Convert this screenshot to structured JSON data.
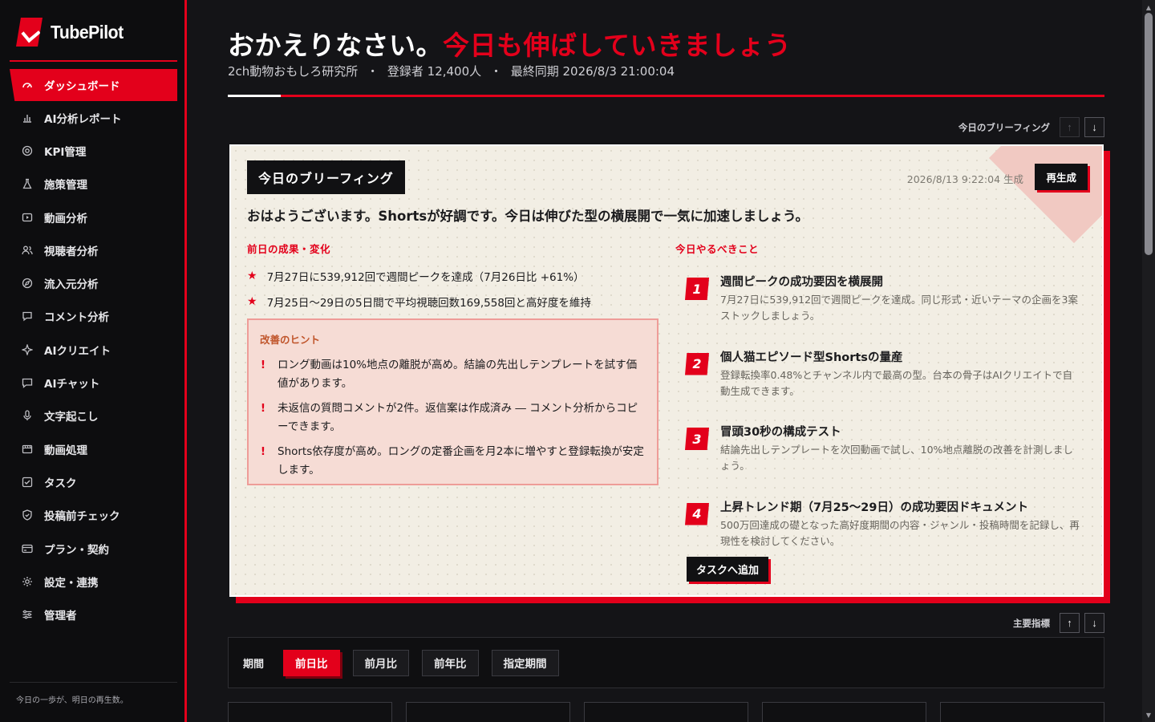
{
  "app": {
    "name": "TubePilot",
    "footer": "今日の一歩が、明日の再生数。"
  },
  "sidebar": {
    "items": [
      {
        "label": "ダッシュボード",
        "icon": "gauge"
      },
      {
        "label": "AI分析レポート",
        "icon": "bar-chart"
      },
      {
        "label": "KPI管理",
        "icon": "target"
      },
      {
        "label": "施策管理",
        "icon": "flask"
      },
      {
        "label": "動画分析",
        "icon": "play"
      },
      {
        "label": "視聴者分析",
        "icon": "users"
      },
      {
        "label": "流入元分析",
        "icon": "compass"
      },
      {
        "label": "コメント分析",
        "icon": "comment"
      },
      {
        "label": "AIクリエイト",
        "icon": "sparkle"
      },
      {
        "label": "AIチャット",
        "icon": "chat"
      },
      {
        "label": "文字起こし",
        "icon": "mic"
      },
      {
        "label": "動画処理",
        "icon": "film"
      },
      {
        "label": "タスク",
        "icon": "check-square"
      },
      {
        "label": "投稿前チェック",
        "icon": "shield"
      },
      {
        "label": "プラン・契約",
        "icon": "card"
      },
      {
        "label": "設定・連携",
        "icon": "gear"
      },
      {
        "label": "管理者",
        "icon": "sliders"
      }
    ],
    "active_index": 0
  },
  "header": {
    "greeting": "おかえりなさい。",
    "greeting_accent": "今日も伸ばしていきましょう",
    "channel": "2ch動物おもしろ研究所",
    "subscribers": "登録者 12,400人",
    "last_sync": "最終同期 2026/8/3 21:00:04",
    "separator": "・"
  },
  "briefing_section": {
    "label": "今日のブリーフィング",
    "up": "↑",
    "down": "↓"
  },
  "briefing": {
    "title": "今日のブリーフィング",
    "generated": "2026/8/13 9:22:04 生成",
    "regen_label": "再生成",
    "lead": "おはようございます。Shortsが好調です。今日は伸びた型の横展開で一気に加速しましょう。",
    "results_head": "前日の成果・変化",
    "results": [
      "7月27日に539,912回で週間ピークを達成（7月26日比 +61%）",
      "7月25日〜29日の5日間で平均視聴回数169,558回と高好度を維持"
    ],
    "hints_head": "改善のヒント",
    "hints": [
      "ロング動画は10%地点の離脱が高め。結論の先出しテンプレートを試す価値があります。",
      "未返信の質問コメントが2件。返信案は作成済み ― コメント分析からコピーできます。",
      "Shorts依存度が高め。ロングの定番企画を月2本に増やすと登録転換が安定します。"
    ],
    "todo_head": "今日やるべきこと",
    "todos": [
      {
        "num": "1",
        "title": "週間ピークの成功要因を横展開",
        "desc": "7月27日に539,912回で週間ピークを達成。同じ形式・近いテーマの企画を3案ストックしましょう。"
      },
      {
        "num": "2",
        "title": "個人猫エピソード型Shortsの量産",
        "desc": "登録転換率0.48%とチャンネル内で最高の型。台本の骨子はAIクリエイトで自動生成できます。"
      },
      {
        "num": "3",
        "title": "冒頭30秒の構成テスト",
        "desc": "結論先出しテンプレートを次回動画で試し、10%地点離脱の改善を計測しましょう。"
      },
      {
        "num": "4",
        "title": "上昇トレンド期（7月25〜29日）の成功要因ドキュメント",
        "desc": "500万回達成の礎となった高好度期間の内容・ジャンル・投稿時間を記録し、再現性を検討してください。"
      }
    ],
    "add_task_label": "タスクへ追加"
  },
  "kpi_section": {
    "label": "主要指標",
    "up": "↑",
    "down": "↓"
  },
  "period": {
    "label": "期間",
    "options": [
      "前日比",
      "前月比",
      "前年比",
      "指定期間"
    ],
    "active_index": 0
  },
  "colors": {
    "accent": "#e3001b",
    "bg": "#141417",
    "card": "#f2eee4"
  }
}
